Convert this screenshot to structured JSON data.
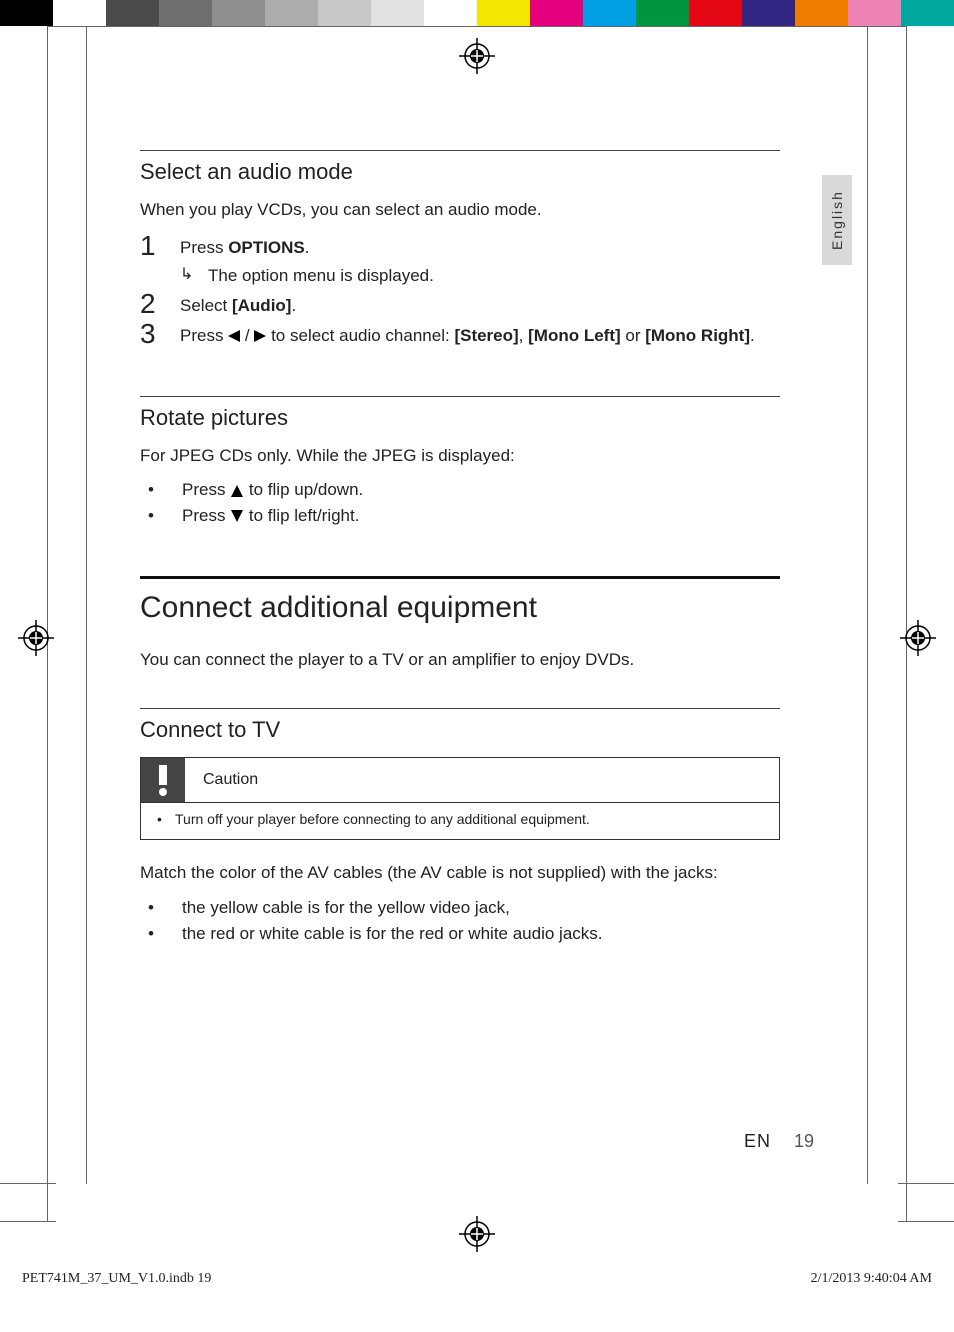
{
  "colorbar": [
    "#000000",
    "#ffffff",
    "#4a4a4a",
    "#6f6f6f",
    "#8f8f8f",
    "#adadad",
    "#c8c8c8",
    "#e2e2e2",
    "#ffffff",
    "#f3e600",
    "#e5007e",
    "#00a0e3",
    "#009640",
    "#e30613",
    "#312783",
    "#ef7d00",
    "#ee82b4",
    "#00a99d"
  ],
  "language_tab": "English",
  "section1": {
    "title": "Select an audio mode",
    "intro": "When you play VCDs, you can select an audio mode.",
    "step1_a": "Press ",
    "step1_b": "OPTIONS",
    "step1_c": ".",
    "step1_sub": "The option menu is displayed.",
    "step2_a": "Select ",
    "step2_b": "[Audio]",
    "step2_c": ".",
    "step3_a": "Press ",
    "step3_b": " / ",
    "step3_c": " to select audio channel: ",
    "step3_d": "[Stereo]",
    "step3_e": ", ",
    "step3_f": "[Mono Left]",
    "step3_g": " or ",
    "step3_h": "[Mono Right]",
    "step3_i": "."
  },
  "section2": {
    "title": "Rotate pictures",
    "intro": "For JPEG CDs only. While the JPEG is displayed:",
    "b1_a": "Press ",
    "b1_b": " to flip up/down.",
    "b2_a": "Press ",
    "b2_b": " to flip left/right."
  },
  "section3": {
    "title": "Connect additional equipment",
    "intro": "You can connect the player to a TV or an amplifier to enjoy DVDs."
  },
  "section4": {
    "title": "Connect to TV",
    "caution_label": "Caution",
    "caution_item": "Turn off your player before connecting to any additional equipment.",
    "after": "Match the color of the AV cables (the AV cable is not supplied) with the jacks:",
    "b1": "the yellow cable is for the yellow video jack,",
    "b2": "the red or white cable is for the red or white audio jacks."
  },
  "footer": {
    "lang": "EN",
    "page": "19",
    "file": "PET741M_37_UM_V1.0.indb   19",
    "timestamp": "2/1/2013   9:40:04 AM"
  }
}
